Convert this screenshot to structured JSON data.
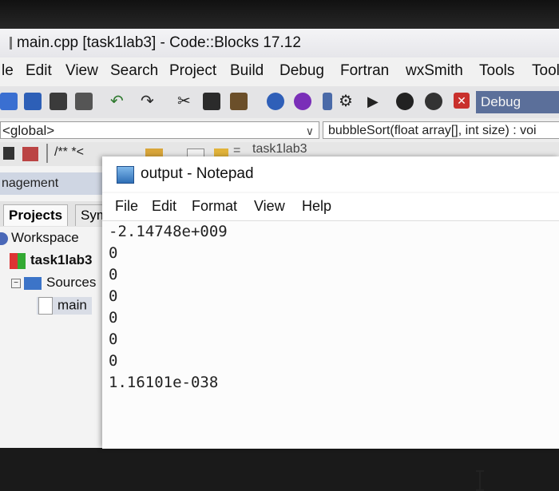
{
  "codeblocks": {
    "title": "main.cpp [task1lab3] - Code::Blocks 17.12",
    "menu": [
      "le",
      "Edit",
      "View",
      "Search",
      "Project",
      "Build",
      "Debug",
      "Fortran",
      "wxSmith",
      "Tools",
      "Tool"
    ],
    "toolbar_target": "Debug",
    "scope": "<global>",
    "function": "bubbleSort(float array[], int size) : voi",
    "toolbar2_text": "/** *<",
    "tab_text": "task1lab3",
    "management": {
      "title": "nagement",
      "tabs": [
        "Projects",
        "Sym"
      ],
      "tree": [
        "Workspace",
        "task1lab3",
        "Sources",
        "main"
      ]
    }
  },
  "notepad": {
    "title": "output - Notepad",
    "menu": [
      "File",
      "Edit",
      "Format",
      "View",
      "Help"
    ],
    "lines": [
      "-2.14748e+009",
      "0",
      "0",
      "0",
      "0",
      "0",
      "0",
      "1.16101e-038"
    ]
  },
  "colors": {
    "highlight": "#cfd6e3",
    "debug_select": "#5b6f9a"
  }
}
